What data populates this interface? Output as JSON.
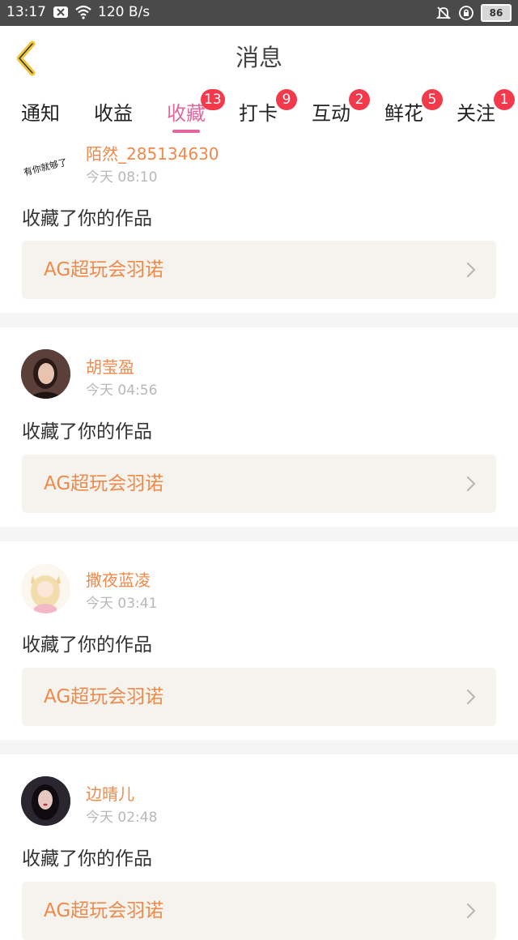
{
  "status_bar": {
    "time": "13:17",
    "net_speed": "120 B/s",
    "battery": "86"
  },
  "header": {
    "title": "消息"
  },
  "tabs": [
    {
      "label": "通知",
      "badge": null
    },
    {
      "label": "收益",
      "badge": null
    },
    {
      "label": "收藏",
      "badge": "13",
      "active": true
    },
    {
      "label": "打卡",
      "badge": "9"
    },
    {
      "label": "互动",
      "badge": "2"
    },
    {
      "label": "鲜花",
      "badge": "5"
    },
    {
      "label": "关注",
      "badge": "1"
    }
  ],
  "notifications": [
    {
      "user": "陌然_285134630",
      "time": "今天 08:10",
      "action": "收藏了你的作品",
      "work": "AG超玩会羽诺",
      "avatar": "handwriting-avatar",
      "avatar_text": "有你就够了"
    },
    {
      "user": "胡莹盈",
      "time": "今天 04:56",
      "action": "收藏了你的作品",
      "work": "AG超玩会羽诺",
      "avatar": "portrait-avatar"
    },
    {
      "user": "撒夜蓝凌",
      "time": "今天 03:41",
      "action": "收藏了你的作品",
      "work": "AG超玩会羽诺",
      "avatar": "anime-avatar"
    },
    {
      "user": "边晴儿",
      "time": "今天 02:48",
      "action": "收藏了你的作品",
      "work": "AG超玩会羽诺",
      "avatar": "portrait-avatar"
    }
  ],
  "colors": {
    "accent": "#e1679d",
    "badge": "#f33a4c",
    "username": "#f0894a",
    "card_bg": "#f4f3ee",
    "back_icon": "#f0c63a"
  }
}
